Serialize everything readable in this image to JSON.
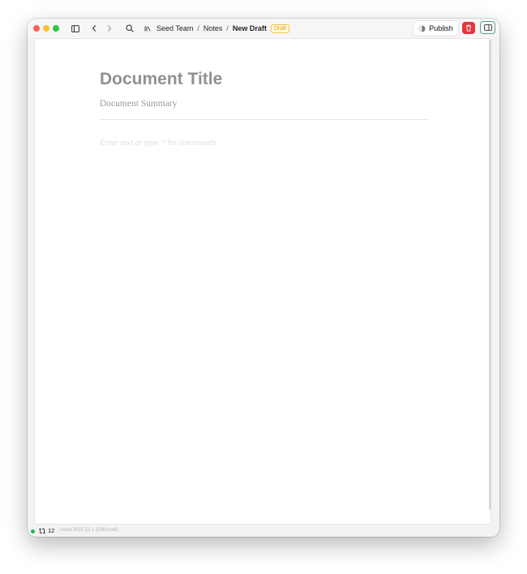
{
  "window": {
    "traffic_colors": {
      "close": "#ff5f57",
      "minimize": "#febc2e",
      "zoom": "#28c840"
    }
  },
  "toolbar": {
    "icons": [
      "sidebar-toggle-icon",
      "chevron-left-icon",
      "chevron-right-icon",
      "search-icon",
      "library-icon"
    ],
    "publish_label": "Publish",
    "colors": {
      "delete": "#e5363b",
      "draft_badge": "#e2a300",
      "panel_toggle_border": "#5fa38c"
    }
  },
  "breadcrumb": {
    "items": [
      "Seed Team",
      "Notes"
    ],
    "separator": "/",
    "current": "New Draft",
    "badge": "Draft"
  },
  "document": {
    "title_placeholder": "Document Title",
    "summary_placeholder": "Document Summary",
    "body_placeholder": "Enter text or type '/' for commands"
  },
  "status": {
    "online_color": "#2bb24c",
    "sync_count": "12",
    "version": "Seed 2025.12.1 (f2d9ccd6)"
  }
}
